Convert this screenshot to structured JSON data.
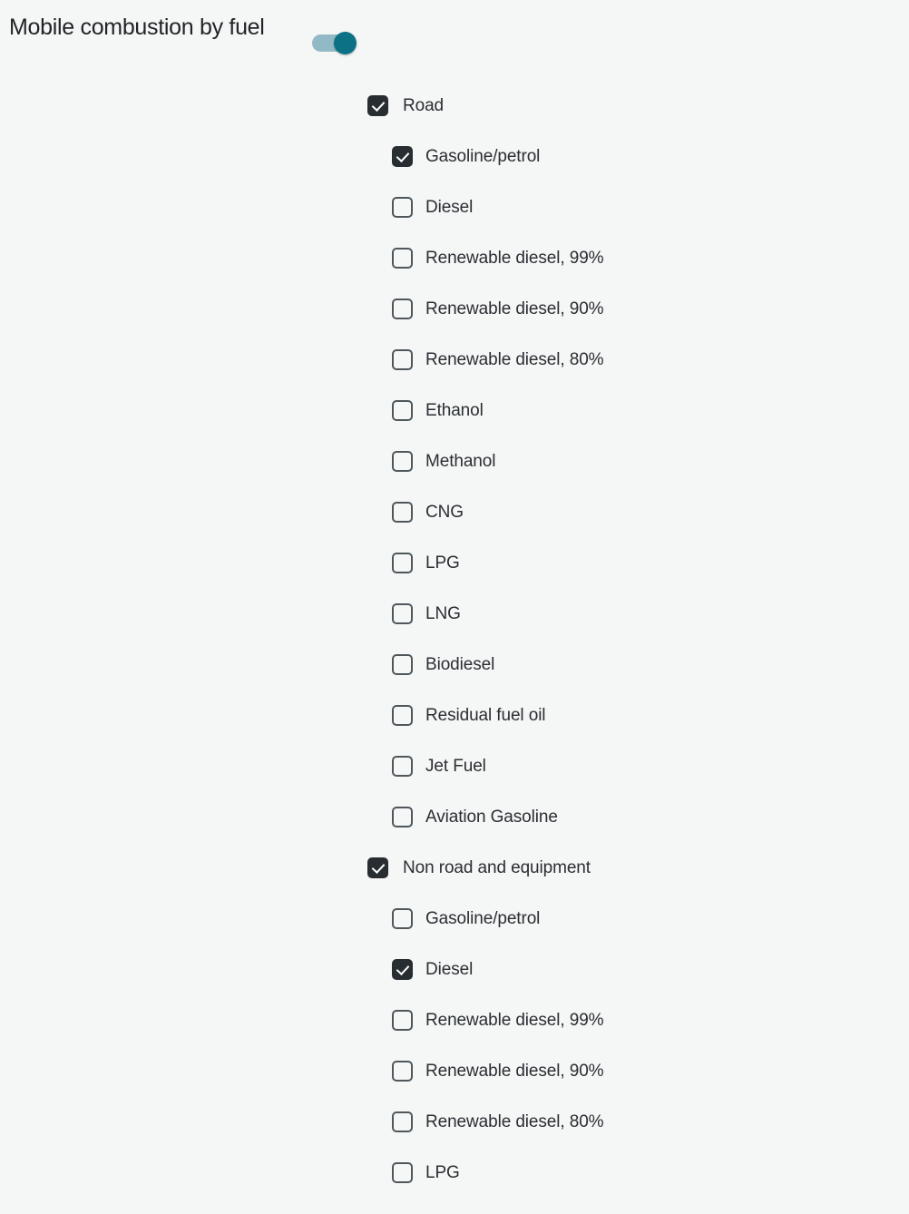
{
  "panel": {
    "title": "Mobile combustion by fuel",
    "toggle": {
      "name": "mobile-combustion-toggle",
      "state": "on",
      "track_color": "#92bac6",
      "knob_color": "#0d7186"
    }
  },
  "colors": {
    "background": "#f5f6f6",
    "title_text": "#1f2427",
    "label_text": "#2a2f33",
    "checkbox_checked_fill": "#282d31",
    "checkbox_unchecked_border": "#4e585c",
    "checkmark": "#ffffff"
  },
  "options": [
    {
      "label": "Road",
      "level": "group",
      "checked": true
    },
    {
      "label": "Gasoline/petrol",
      "level": "child",
      "checked": true
    },
    {
      "label": "Diesel",
      "level": "child",
      "checked": false
    },
    {
      "label": "Renewable diesel, 99%",
      "level": "child",
      "checked": false
    },
    {
      "label": "Renewable diesel, 90%",
      "level": "child",
      "checked": false
    },
    {
      "label": "Renewable diesel, 80%",
      "level": "child",
      "checked": false
    },
    {
      "label": "Ethanol",
      "level": "child",
      "checked": false
    },
    {
      "label": "Methanol",
      "level": "child",
      "checked": false
    },
    {
      "label": "CNG",
      "level": "child",
      "checked": false
    },
    {
      "label": "LPG",
      "level": "child",
      "checked": false
    },
    {
      "label": "LNG",
      "level": "child",
      "checked": false
    },
    {
      "label": "Biodiesel",
      "level": "child",
      "checked": false
    },
    {
      "label": "Residual fuel oil",
      "level": "child",
      "checked": false
    },
    {
      "label": "Jet Fuel",
      "level": "child",
      "checked": false
    },
    {
      "label": "Aviation Gasoline",
      "level": "child",
      "checked": false
    },
    {
      "label": "Non road and equipment",
      "level": "group",
      "checked": true
    },
    {
      "label": "Gasoline/petrol",
      "level": "child",
      "checked": false
    },
    {
      "label": "Diesel",
      "level": "child",
      "checked": true
    },
    {
      "label": "Renewable diesel, 99%",
      "level": "child",
      "checked": false
    },
    {
      "label": "Renewable diesel, 90%",
      "level": "child",
      "checked": false
    },
    {
      "label": "Renewable diesel, 80%",
      "level": "child",
      "checked": false
    },
    {
      "label": "LPG",
      "level": "child",
      "checked": false
    }
  ]
}
